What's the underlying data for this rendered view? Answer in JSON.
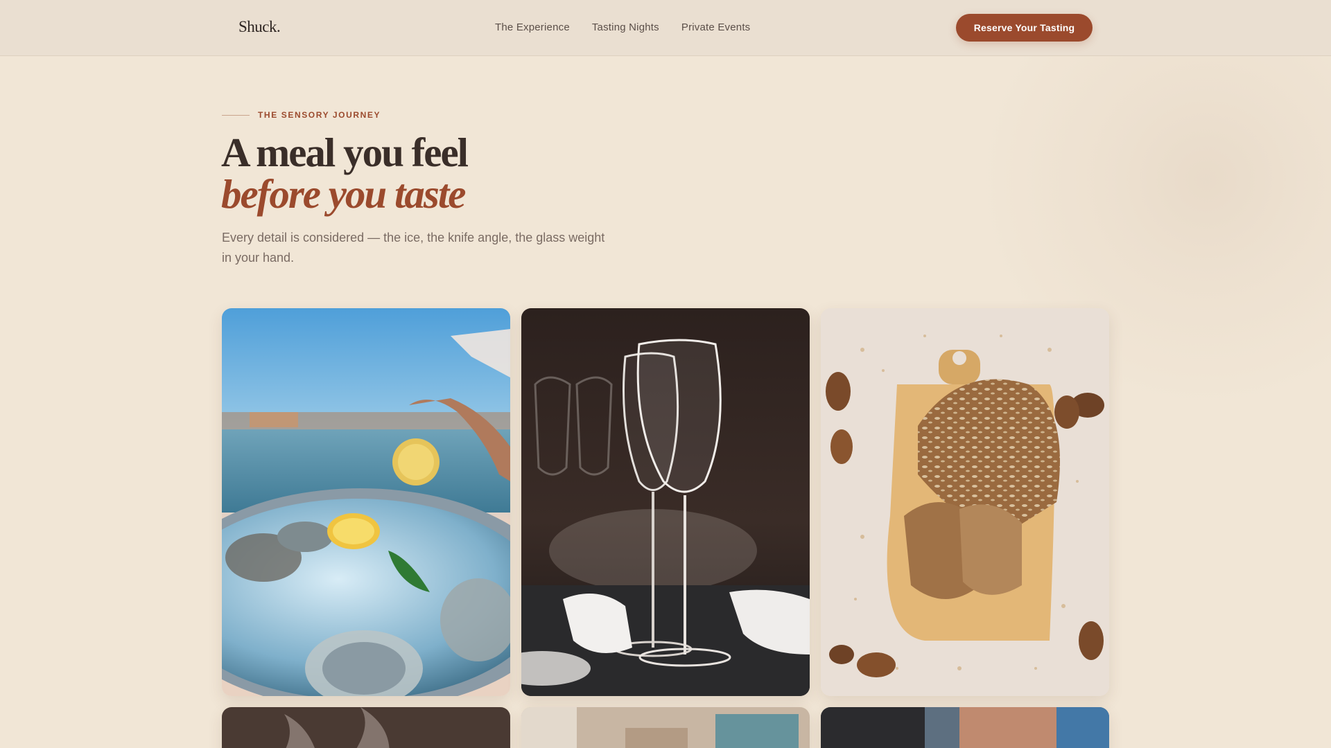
{
  "brand": {
    "name": "Shuck",
    "dot": "."
  },
  "nav": {
    "links": [
      "The Experience",
      "Tasting Nights",
      "Private Events"
    ],
    "cta": "Reserve Your Tasting"
  },
  "hero": {
    "eyebrow": "THE SENSORY JOURNEY",
    "title_line1": "A meal you feel",
    "title_line2": "before you taste",
    "lede": "Every detail is considered — the ice, the knife angle, the glass weight in your hand."
  },
  "gallery": {
    "items": [
      {
        "icon": "oysters-lemon-photo"
      },
      {
        "icon": "wine-glasses-photo"
      },
      {
        "icon": "seeded-bread-photo"
      },
      {
        "icon": "steam-photo"
      },
      {
        "icon": "table-setting-photo"
      },
      {
        "icon": "chef-photo"
      }
    ]
  },
  "colors": {
    "background": "#f1e6d6",
    "nav_bg": "#eadfd1",
    "accent": "#9b4a2d",
    "heading": "#3a2e29",
    "body_text": "#7a6b63"
  }
}
